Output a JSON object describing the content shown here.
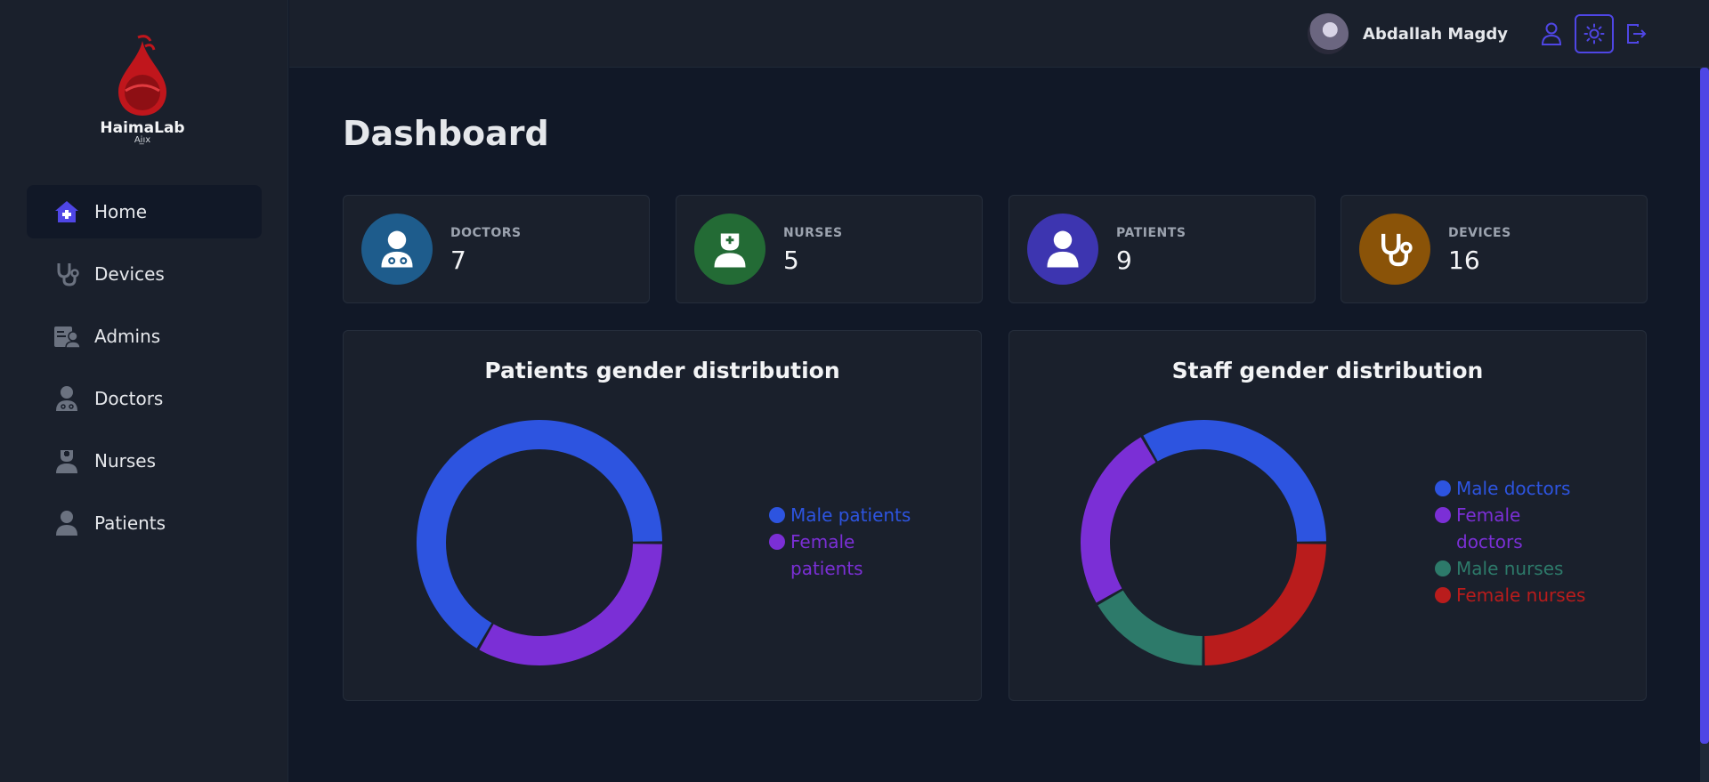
{
  "app": {
    "brand_name": "HaimaLab",
    "brand_sub": "Ai̲ıx"
  },
  "sidebar": {
    "items": [
      {
        "label": "Home",
        "icon": "home-medical-icon",
        "active": true
      },
      {
        "label": "Devices",
        "icon": "stethoscope-icon",
        "active": false
      },
      {
        "label": "Admins",
        "icon": "id-card-user-icon",
        "active": false
      },
      {
        "label": "Doctors",
        "icon": "doctor-icon",
        "active": false
      },
      {
        "label": "Nurses",
        "icon": "nurse-icon",
        "active": false
      },
      {
        "label": "Patients",
        "icon": "user-icon",
        "active": false
      }
    ]
  },
  "header": {
    "user_name": "Abdallah Magdy",
    "buttons": [
      "profile-icon",
      "sun-icon",
      "logout-icon"
    ]
  },
  "main": {
    "title": "Dashboard",
    "stats": [
      {
        "label": "DOCTORS",
        "value": "7",
        "color": "#1e5c8c",
        "icon": "doctor-icon"
      },
      {
        "label": "NURSES",
        "value": "5",
        "color": "#236b35",
        "icon": "nurse-icon"
      },
      {
        "label": "PATIENTS",
        "value": "9",
        "color": "#3d35b0",
        "icon": "user-icon"
      },
      {
        "label": "DEVICES",
        "value": "16",
        "color": "#8a5308",
        "icon": "stethoscope-icon"
      }
    ]
  },
  "colors": {
    "accent": "#4f46e5",
    "male": "#2d54e0",
    "female": "#7b2fd6",
    "male_nurses": "#2d7a6a",
    "female_nurses": "#b91c1c"
  },
  "chart_data": [
    {
      "type": "pie",
      "title": "Patients gender distribution",
      "labels": [
        "Male patients",
        "Female patients"
      ],
      "values": [
        6,
        3
      ],
      "colors": [
        "#2d54e0",
        "#7b2fd6"
      ]
    },
    {
      "type": "pie",
      "title": "Staff gender distribution",
      "labels": [
        "Male doctors",
        "Female doctors",
        "Male nurses",
        "Female nurses"
      ],
      "values": [
        4,
        3,
        2,
        3
      ],
      "colors": [
        "#2d54e0",
        "#7b2fd6",
        "#2d7a6a",
        "#b91c1c"
      ]
    }
  ]
}
